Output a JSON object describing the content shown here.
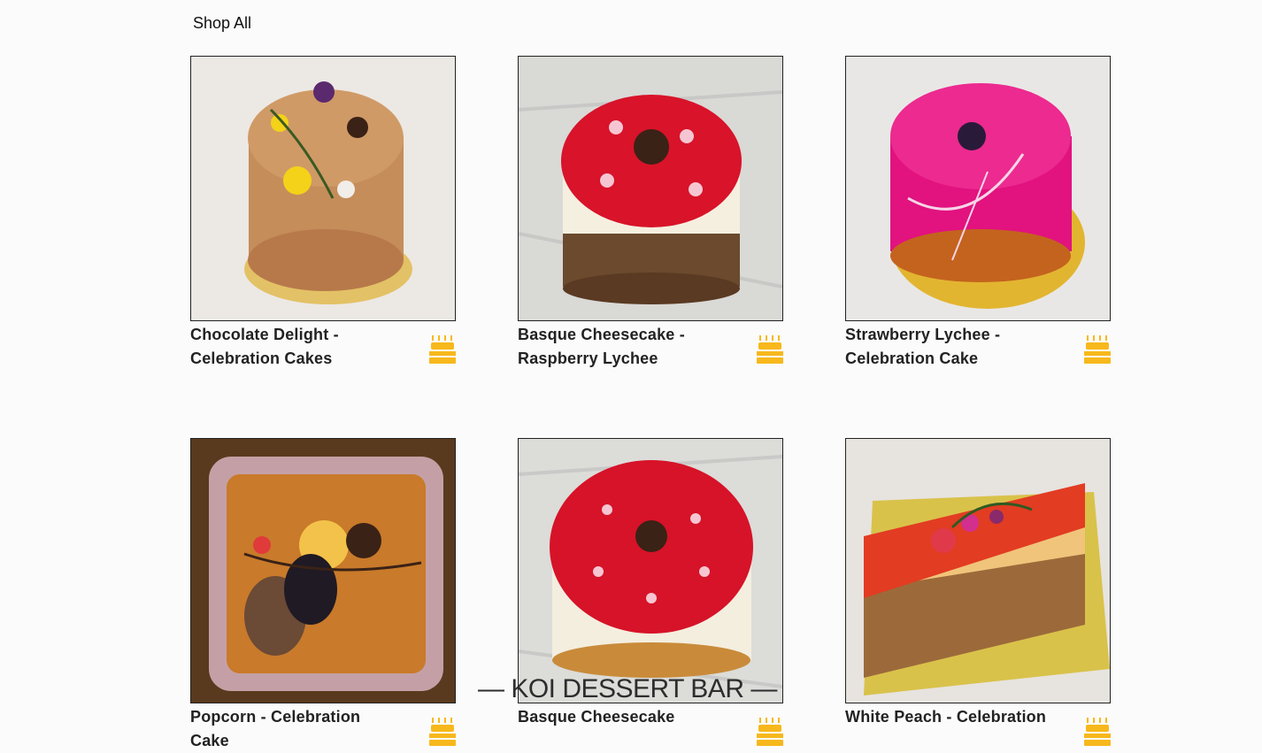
{
  "header": {
    "shop_all": "Shop All"
  },
  "colors": {
    "accent": "#f7b81c",
    "text": "#222222"
  },
  "products": [
    {
      "name": "Chocolate Delight - Celebration Cakes",
      "icon": "birthday-cake-icon",
      "image": "chocolate-delight-cake-photo"
    },
    {
      "name": "Basque Cheesecake - Raspberry Lychee",
      "icon": "birthday-cake-icon",
      "image": "basque-cheesecake-raspberry-photo"
    },
    {
      "name": "Strawberry Lychee - Celebration Cake",
      "icon": "birthday-cake-icon",
      "image": "strawberry-lychee-cake-photo"
    },
    {
      "name": "Popcorn - Celebration Cake",
      "icon": "birthday-cake-icon",
      "image": "popcorn-cake-photo"
    },
    {
      "name": "Basque Cheesecake",
      "icon": "birthday-cake-icon",
      "image": "basque-cheesecake-photo"
    },
    {
      "name": "White Peach - Celebration",
      "icon": "birthday-cake-icon",
      "image": "white-peach-cake-photo"
    }
  ],
  "overlay": {
    "brand": "— KOI DESSERT BAR —"
  }
}
